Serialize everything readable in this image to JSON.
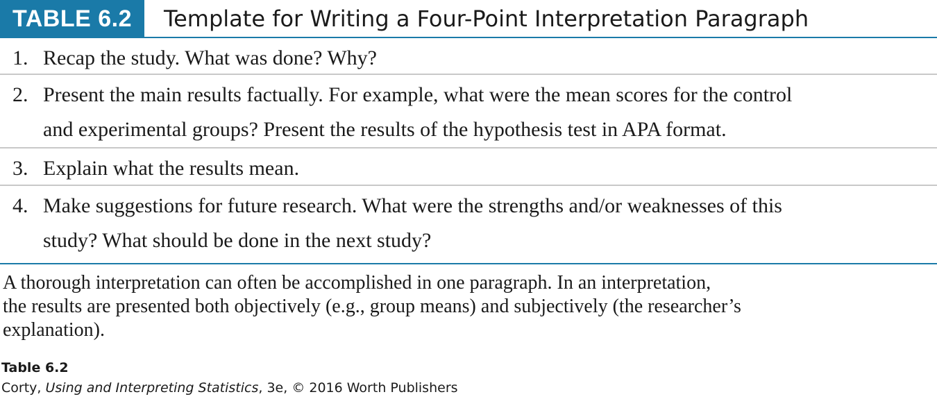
{
  "table": {
    "label": "TABLE 6.2",
    "title": "Template for Writing a Four-Point Interpretation Paragraph",
    "rows": [
      {
        "number": "1.",
        "lines": [
          "Recap the study. What was done? Why?"
        ]
      },
      {
        "number": "2.",
        "lines": [
          "Present the main results factually. For example, what were the mean scores for the control",
          "and experimental groups? Present the results of the hypothesis test in APA format."
        ]
      },
      {
        "number": "3.",
        "lines": [
          "Explain what the results mean."
        ]
      },
      {
        "number": "4.",
        "lines": [
          "Make suggestions for future research. What were the strengths and/or weaknesses of this",
          "study? What should be done in the next study?"
        ]
      }
    ]
  },
  "caption": {
    "lines": [
      "A thorough interpretation can often be accomplished in one paragraph. In an interpretation,",
      "the results are presented both objectively (e.g., group means) and subjectively (the researcher’s",
      "explanation)."
    ]
  },
  "source": {
    "title": "Table 6.2",
    "author": "Corty, ",
    "book": "Using and Interpreting Statistics",
    "edition": ", 3e, © 2016 Worth Publishers"
  },
  "colors": {
    "accent": "#1a7aa8",
    "row_rule": "#c8c8c8"
  }
}
